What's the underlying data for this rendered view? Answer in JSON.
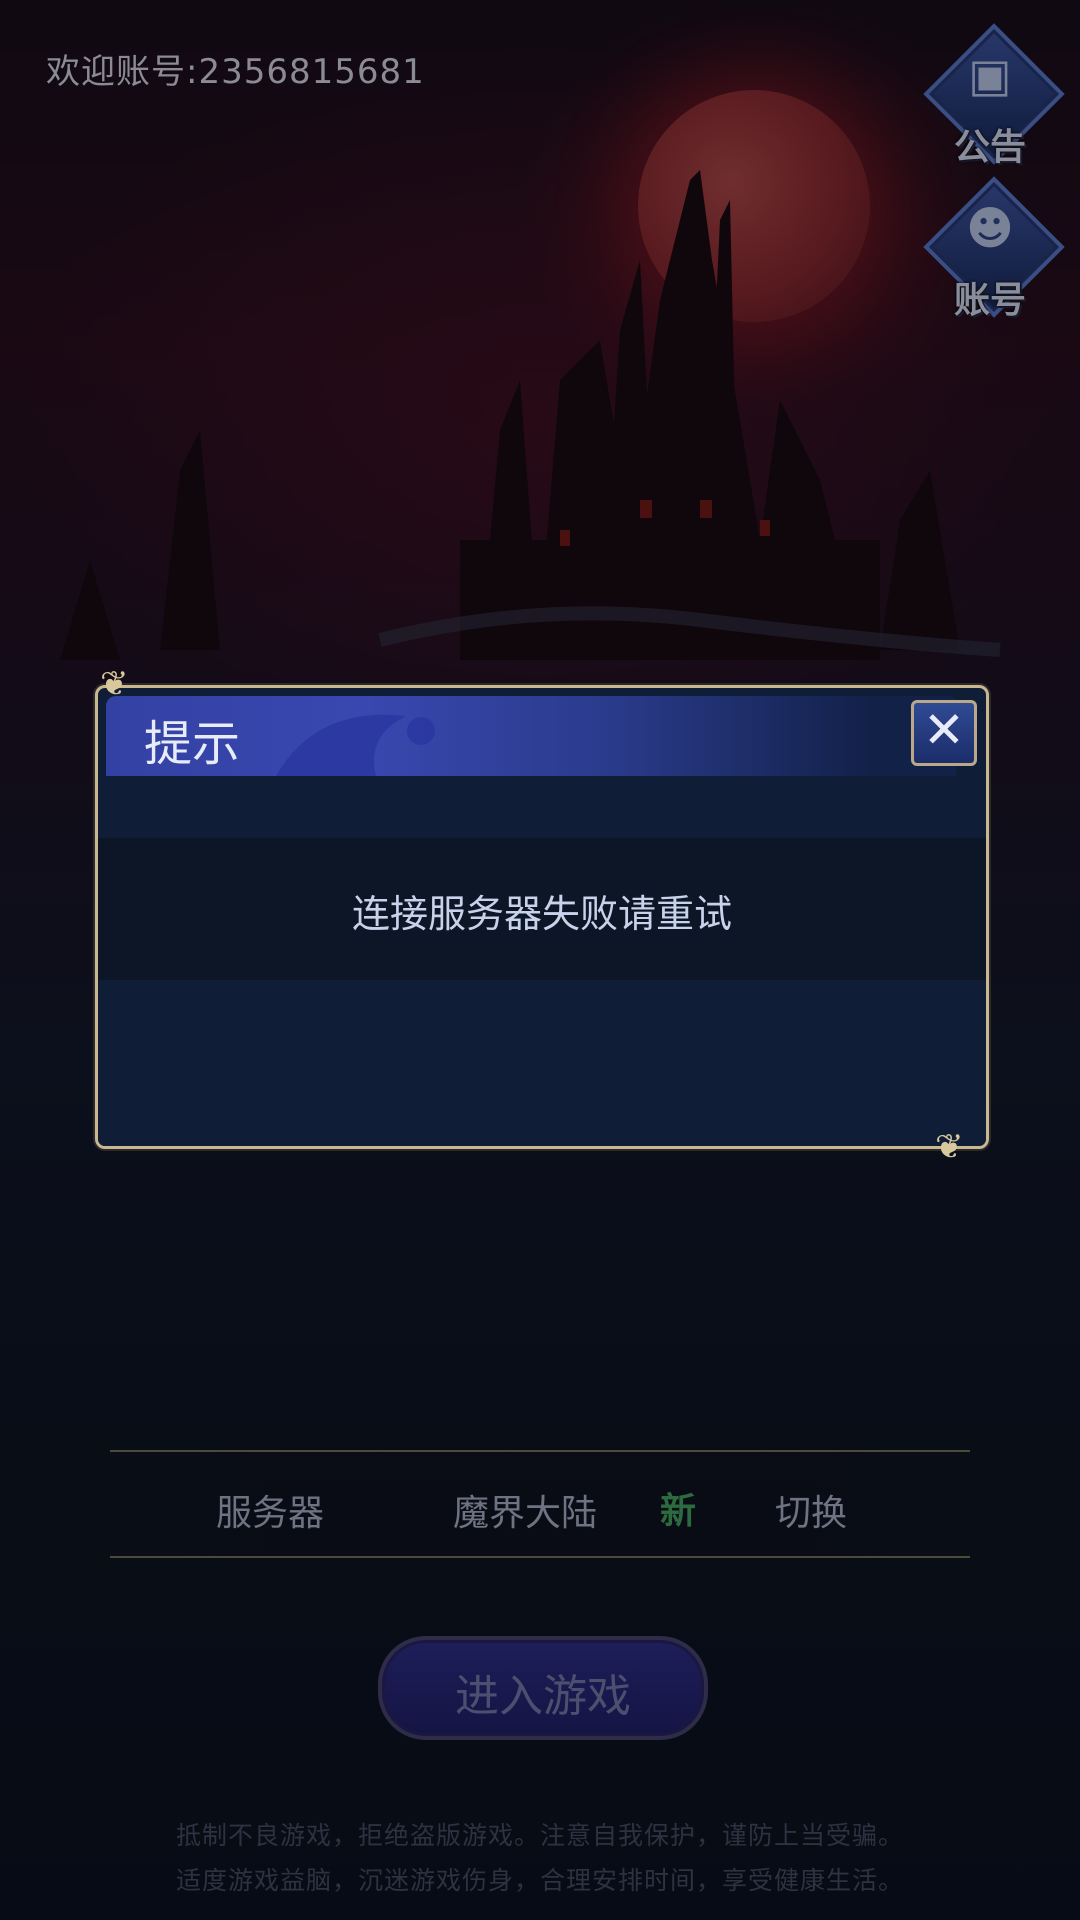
{
  "header": {
    "welcome": "欢迎账号:2356815681"
  },
  "side_buttons": [
    {
      "label": "公告",
      "icon": "announcement-board-icon"
    },
    {
      "label": "账号",
      "icon": "account-avatar-icon"
    }
  ],
  "dialog": {
    "title": "提示",
    "message": "连接服务器失败请重试",
    "close_icon": "close-x-icon"
  },
  "server": {
    "label": "服务器",
    "name": "魔界大陆",
    "badge": "新",
    "switch_label": "切换"
  },
  "enter_button": {
    "label": "进入游戏"
  },
  "notice": {
    "line1": "抵制不良游戏，拒绝盗版游戏。注意自我保护，谨防上当受骗。",
    "line2": "适度游戏益脑，沉迷游戏伤身，合理安排时间，享受健康生活。"
  }
}
